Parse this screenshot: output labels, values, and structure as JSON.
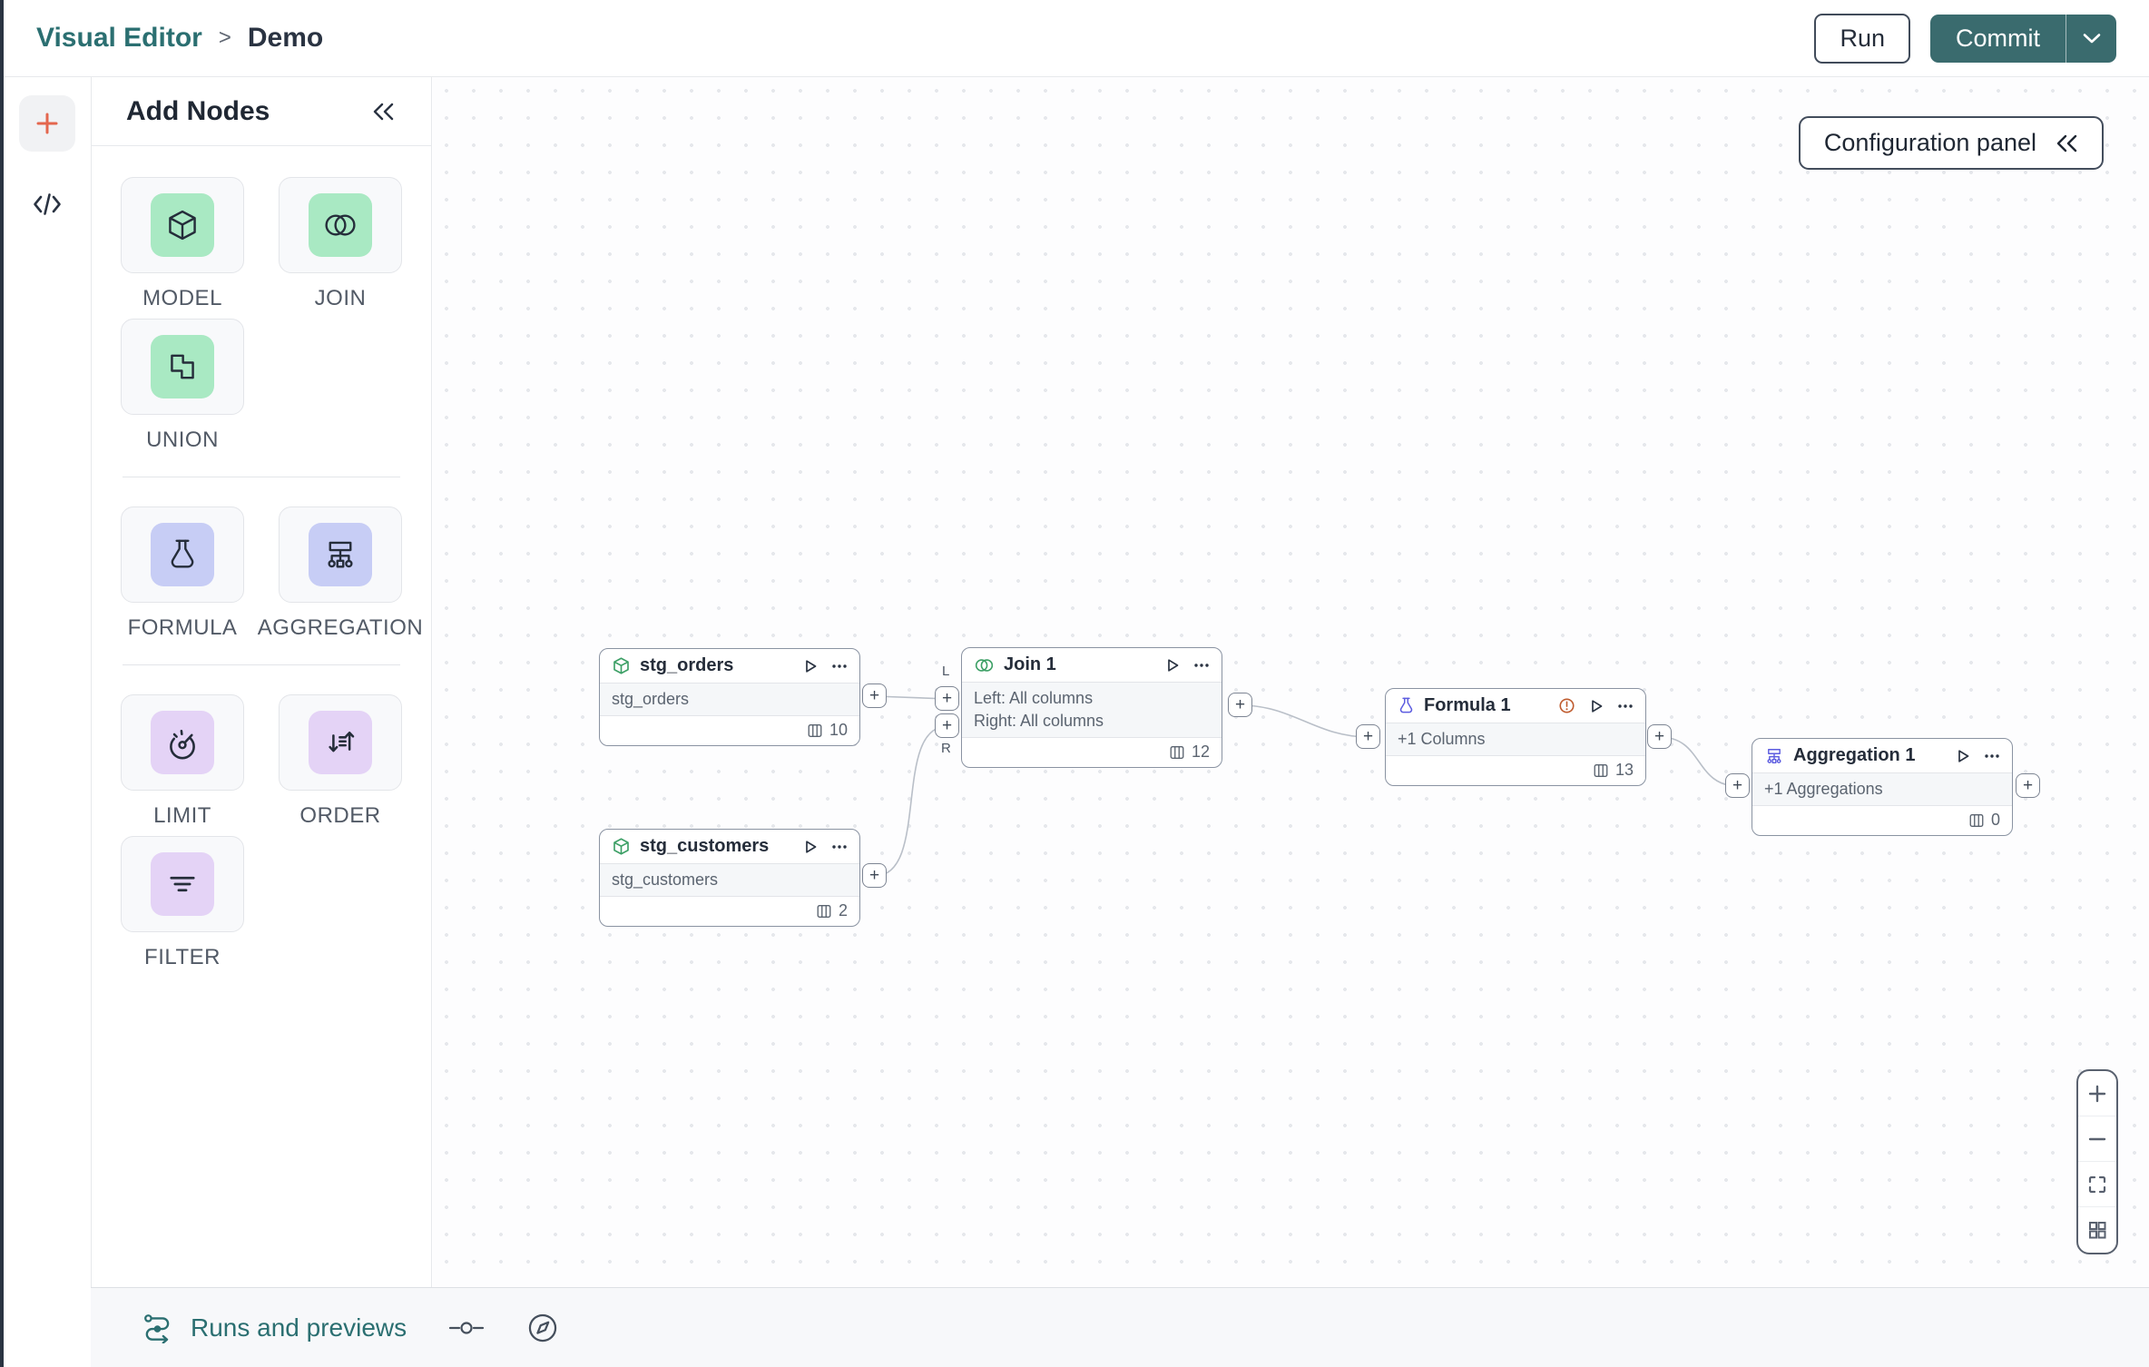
{
  "header": {
    "breadcrumb": {
      "root": "Visual Editor",
      "separator": ">",
      "current": "Demo"
    },
    "run_label": "Run",
    "commit_label": "Commit"
  },
  "panel": {
    "title": "Add Nodes",
    "tiles": [
      {
        "label": "MODEL",
        "icon": "model-cube-icon",
        "color": "green"
      },
      {
        "label": "JOIN",
        "icon": "join-venn-icon",
        "color": "green"
      },
      {
        "label": "UNION",
        "icon": "union-squares-icon",
        "color": "green"
      },
      {
        "label": "FORMULA",
        "icon": "formula-flask-icon",
        "color": "periwinkle"
      },
      {
        "label": "AGGREGATION",
        "icon": "aggregation-tree-icon",
        "color": "periwinkle"
      },
      {
        "label": "LIMIT",
        "icon": "limit-gauge-icon",
        "color": "lilac"
      },
      {
        "label": "ORDER",
        "icon": "order-sort-icon",
        "color": "lilac"
      },
      {
        "label": "FILTER",
        "icon": "filter-lines-icon",
        "color": "lilac"
      }
    ]
  },
  "canvas": {
    "config_panel_label": "Configuration panel",
    "plus": "+",
    "port_labels": {
      "left": "L",
      "right": "R"
    },
    "nodes": [
      {
        "title": "stg_orders",
        "type": "model",
        "body": [
          "stg_orders"
        ],
        "count": "10"
      },
      {
        "title": "stg_customers",
        "type": "model",
        "body": [
          "stg_customers"
        ],
        "count": "2"
      },
      {
        "title": "Join 1",
        "type": "join",
        "body": [
          "Left: All columns",
          "Right: All columns"
        ],
        "count": "12"
      },
      {
        "title": "Formula 1",
        "type": "formula",
        "body": [
          "+1 Columns"
        ],
        "count": "13",
        "warning": true
      },
      {
        "title": "Aggregation 1",
        "type": "aggregation",
        "body": [
          "+1 Aggregations"
        ],
        "count": "0"
      }
    ]
  },
  "bottom_bar": {
    "label": "Runs and previews"
  },
  "colors": {
    "teal_link": "#2b6f71",
    "commit_bg": "#3a6b6e",
    "accent_orange": "#e4674e",
    "node_green": "#3da066",
    "node_indigo": "#5c5ce0",
    "warning_orange": "#bf5b2e",
    "tile_green": "#a9e9c3",
    "tile_periwinkle": "#c7cdf5",
    "tile_lilac": "#e4d3f6",
    "canvas_dot": "#e6e8ec"
  }
}
